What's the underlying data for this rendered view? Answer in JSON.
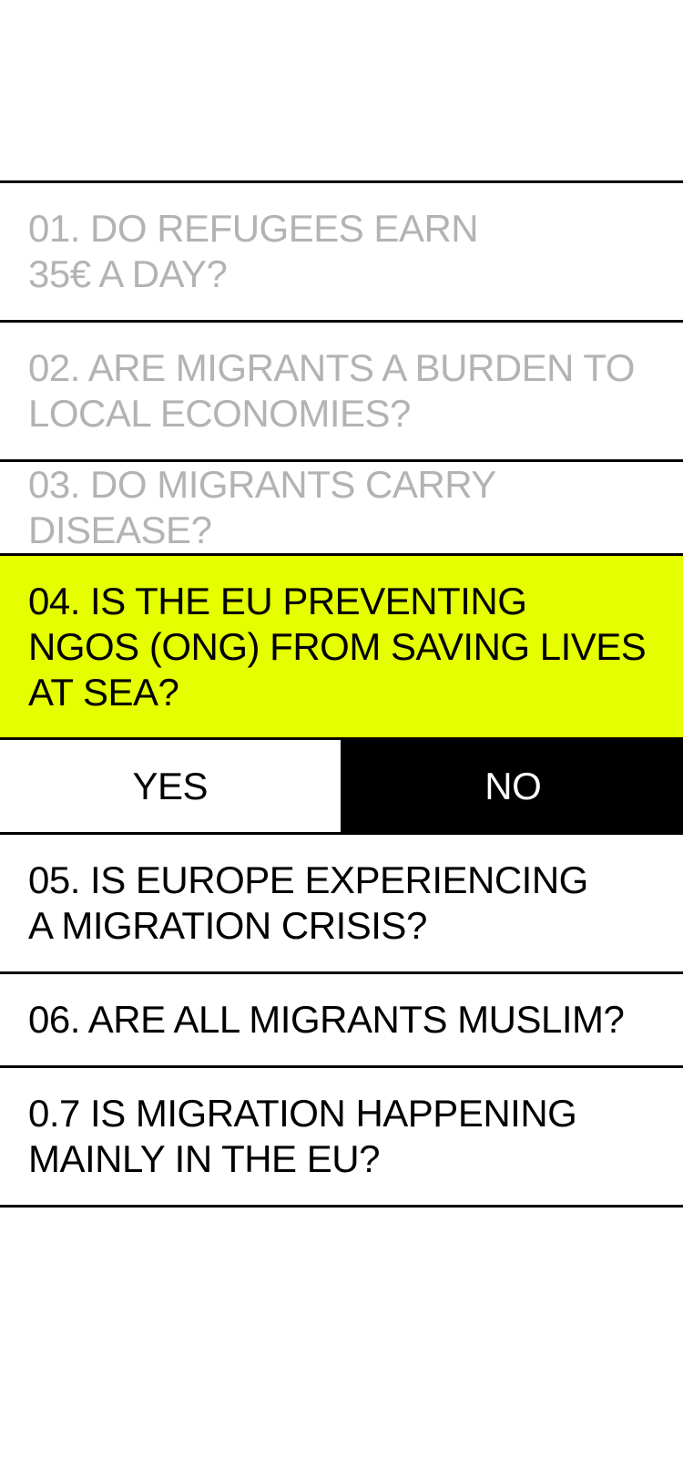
{
  "questions": [
    {
      "text": "01. DO REFUGEES EARN\n35€ A DAY?",
      "state": "answered"
    },
    {
      "text": "02. ARE MIGRANTS A BURDEN TO\nLOCAL ECONOMIES?",
      "state": "answered"
    },
    {
      "text": "03. DO MIGRANTS CARRY DISEASE?",
      "state": "answered"
    },
    {
      "text": "04. IS THE EU PREVENTING\nNGOS (ONG) FROM SAVING LIVES\nAT SEA?",
      "state": "active"
    },
    {
      "text": "05. IS EUROPE EXPERIENCING\nA MIGRATION CRISIS?",
      "state": "pending"
    },
    {
      "text": "06. ARE ALL MIGRANTS MUSLIM?",
      "state": "pending"
    },
    {
      "text": "0.7 IS MIGRATION HAPPENING\nMAINLY IN THE EU?",
      "state": "pending"
    }
  ],
  "answers": {
    "yes_label": "YES",
    "no_label": "NO",
    "selected": "NO"
  },
  "colors": {
    "active_background": "#e5ff00",
    "answered_text": "#b3b3b3",
    "pending_text": "#000000",
    "rule": "#000000"
  }
}
